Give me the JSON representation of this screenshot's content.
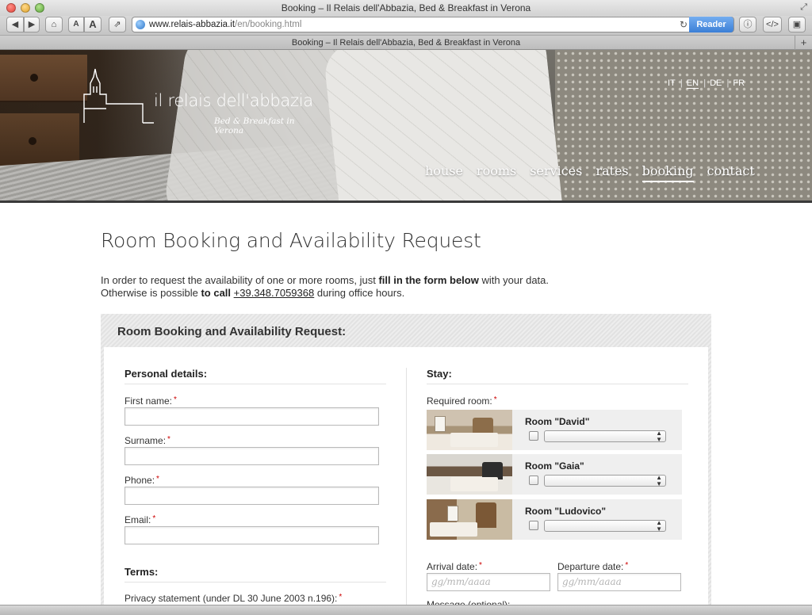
{
  "browser": {
    "window_title": "Booking – Il Relais dell'Abbazia, Bed & Breakfast in Verona",
    "tab_title": "Booking – Il Relais dell'Abbazia, Bed & Breakfast in Verona",
    "url_domain": "www.relais-abbazia.it",
    "url_path": "/en/booking.html",
    "reader_label": "Reader",
    "font_small_label": "A",
    "font_big_label": "A",
    "new_tab_label": "+"
  },
  "header": {
    "brand": "il relais dell'abbazia",
    "tagline": "Bed & Breakfast in Verona",
    "languages": [
      {
        "code": "IT",
        "active": false
      },
      {
        "code": "EN",
        "active": true
      },
      {
        "code": "DE",
        "active": false
      },
      {
        "code": "FR",
        "active": false
      }
    ],
    "nav": [
      {
        "label": "house",
        "active": false
      },
      {
        "label": "rooms",
        "active": false
      },
      {
        "label": "services",
        "active": false
      },
      {
        "label": "rates",
        "active": false
      },
      {
        "label": "booking",
        "active": true
      },
      {
        "label": "contact",
        "active": false
      }
    ]
  },
  "page": {
    "title": "Room Booking and Availability Request",
    "intro_line1_pre": "In order to request the availability of one or more rooms, just ",
    "intro_line1_bold": "fill in the form below",
    "intro_line1_post": " with your data.",
    "intro_line2_pre": "Otherwise is possible ",
    "intro_line2_bold": "to call",
    "intro_phone": "+39.348.7059368",
    "intro_line2_post": " during office hours."
  },
  "form": {
    "panel_title": "Room Booking and Availability Request:",
    "personal": {
      "heading": "Personal details:",
      "first_name_label": "First name:",
      "surname_label": "Surname:",
      "phone_label": "Phone:",
      "email_label": "Email:",
      "required_mark": "*"
    },
    "terms": {
      "heading": "Terms:",
      "privacy_label": "Privacy statement (under DL 30 June 2003 n.196):"
    },
    "stay": {
      "heading": "Stay:",
      "required_room_label": "Required room:",
      "rooms": [
        {
          "name": "Room \"David\""
        },
        {
          "name": "Room \"Gaia\""
        },
        {
          "name": "Room \"Ludovico\""
        }
      ],
      "arrival_label": "Arrival date:",
      "departure_label": "Departure date:",
      "date_placeholder": "gg/mm/aaaa",
      "message_label": "Message (optional):"
    }
  }
}
